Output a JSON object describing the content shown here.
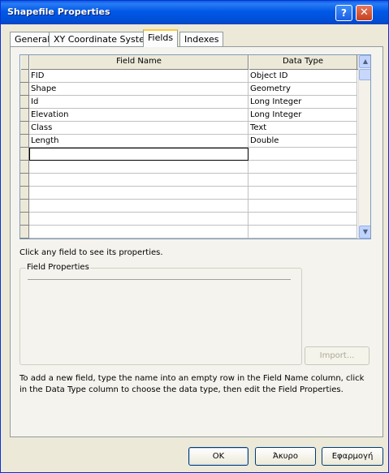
{
  "window": {
    "title": "Shapefile Properties"
  },
  "title_buttons": {
    "help": "?",
    "close": "✕"
  },
  "tabs": [
    {
      "label": "General",
      "active": false
    },
    {
      "label": "XY Coordinate System",
      "active": false
    },
    {
      "label": "Fields",
      "active": true
    },
    {
      "label": "Indexes",
      "active": false
    }
  ],
  "grid": {
    "headers": [
      "Field Name",
      "Data Type"
    ],
    "rows": [
      {
        "name": "FID",
        "type": "Object ID"
      },
      {
        "name": "Shape",
        "type": "Geometry"
      },
      {
        "name": "Id",
        "type": "Long Integer"
      },
      {
        "name": "Elevation",
        "type": "Long Integer"
      },
      {
        "name": "Class",
        "type": "Text"
      },
      {
        "name": "Length",
        "type": "Double"
      },
      {
        "name": "",
        "type": ""
      },
      {
        "name": "",
        "type": ""
      },
      {
        "name": "",
        "type": ""
      },
      {
        "name": "",
        "type": ""
      },
      {
        "name": "",
        "type": ""
      },
      {
        "name": "",
        "type": ""
      },
      {
        "name": "",
        "type": ""
      }
    ],
    "scroll_up": "▲",
    "scroll_down": "▼"
  },
  "hint": "Click any field to see its properties.",
  "field_properties": {
    "legend": "Field Properties"
  },
  "import_button": "Import...",
  "info_text": "To add a new field, type the name into an empty row in the Field Name column, click in the Data Type column to choose the data type, then edit the Field Properties.",
  "footer": {
    "ok": "OK",
    "cancel": "Άκυρο",
    "apply": "Εφαρμογή"
  }
}
